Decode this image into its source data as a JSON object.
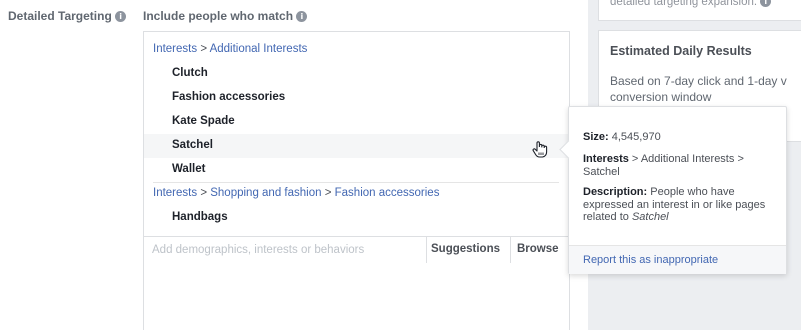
{
  "detailed_targeting": {
    "label": "Detailed Targeting",
    "info_icon": "i"
  },
  "include": {
    "label": "Include people who match",
    "info_icon": "i"
  },
  "groups": [
    {
      "path": [
        "Interests",
        "Additional Interests"
      ],
      "items": [
        "Clutch",
        "Fashion accessories",
        "Kate Spade",
        "Satchel",
        "Wallet"
      ]
    },
    {
      "path": [
        "Interests",
        "Shopping and fashion",
        "Fashion accessories"
      ],
      "items": [
        "Handbags"
      ]
    }
  ],
  "separator": ">",
  "search": {
    "placeholder": "Add demographics, interests or behaviors",
    "suggestions_label": "Suggestions",
    "browse_label": "Browse"
  },
  "expansion_card": {
    "text": "detailed targeting expansion.",
    "info_icon": "i"
  },
  "estimated": {
    "title": "Estimated Daily Results",
    "body_line1": "Based on 7-day click and 1-day v",
    "body_line2": "conversion window"
  },
  "tooltip": {
    "size_label": "Size:",
    "size_value": "4,545,970",
    "interests_label": "Interests",
    "interests_path_1": "Additional Interests",
    "interests_path_2": "Satchel",
    "description_label": "Description:",
    "description_text": "People who have expressed an interest in or like pages related to",
    "description_subject": "Satchel",
    "report_link": "Report this as inappropriate"
  },
  "colors": {
    "link": "#4267b2",
    "highlight": "#f5f6f7",
    "panel": "#eceef1"
  },
  "icons": {
    "cursor": "hand-cursor-icon",
    "info": "info-icon"
  }
}
